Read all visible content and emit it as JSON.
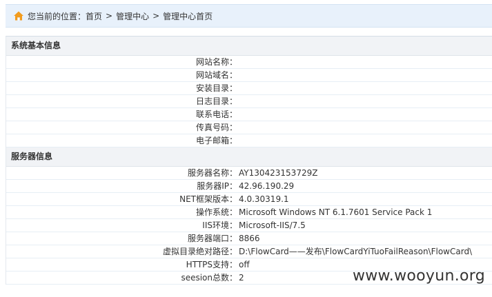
{
  "breadcrumb": {
    "prefix": "您当前的位置：",
    "items": [
      "首页",
      "管理中心",
      "管理中心首页"
    ],
    "separator": ">"
  },
  "system_info": {
    "title": "系统基本信息",
    "rows": [
      {
        "label": "网站名称：",
        "value": ""
      },
      {
        "label": "网站域名：",
        "value": ""
      },
      {
        "label": "安装目录：",
        "value": ""
      },
      {
        "label": "日志目录：",
        "value": ""
      },
      {
        "label": "联系电话：",
        "value": ""
      },
      {
        "label": "传真号码：",
        "value": ""
      },
      {
        "label": "电子邮箱：",
        "value": ""
      }
    ]
  },
  "server_info": {
    "title": "服务器信息",
    "rows": [
      {
        "label": "服务器名称：",
        "value": "AY130423153729Z"
      },
      {
        "label": "服务器IP：",
        "value": "42.96.190.29"
      },
      {
        "label": "NET框架版本：",
        "value": "4.0.30319.1"
      },
      {
        "label": "操作系统：",
        "value": "Microsoft Windows NT 6.1.7601 Service Pack 1"
      },
      {
        "label": "IIS环境：",
        "value": "Microsoft-IIS/7.5"
      },
      {
        "label": "服务器端口：",
        "value": "8866"
      },
      {
        "label": "虚拟目录绝对路径：",
        "value": "D:\\FlowCard——发布\\FlowCardYiTuoFailReason\\FlowCard\\"
      },
      {
        "label": "HTTPS支持：",
        "value": "off"
      },
      {
        "label": "seesion总数：",
        "value": "2"
      }
    ]
  },
  "watermark": "www.wooyun.org",
  "colors": {
    "breadcrumb_bg": "#e8f1fb",
    "section_bg": "#f1f3f6",
    "home_icon": "#f29c1f"
  }
}
